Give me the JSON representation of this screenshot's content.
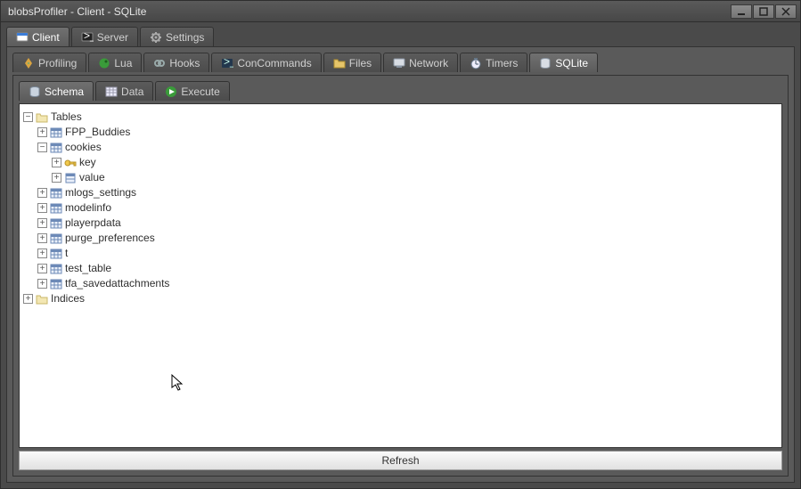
{
  "title": "blobsProfiler - Client - SQLite",
  "top_tabs": [
    {
      "id": "client",
      "label": "Client",
      "active": true
    },
    {
      "id": "server",
      "label": "Server",
      "active": false
    },
    {
      "id": "settings",
      "label": "Settings",
      "active": false
    }
  ],
  "mid_tabs": [
    {
      "id": "profiling",
      "label": "Profiling",
      "active": false
    },
    {
      "id": "lua",
      "label": "Lua",
      "active": false
    },
    {
      "id": "hooks",
      "label": "Hooks",
      "active": false
    },
    {
      "id": "concommands",
      "label": "ConCommands",
      "active": false
    },
    {
      "id": "files",
      "label": "Files",
      "active": false
    },
    {
      "id": "network",
      "label": "Network",
      "active": false
    },
    {
      "id": "timers",
      "label": "Timers",
      "active": false
    },
    {
      "id": "sqlite",
      "label": "SQLite",
      "active": true
    }
  ],
  "inner_tabs": [
    {
      "id": "schema",
      "label": "Schema",
      "active": true
    },
    {
      "id": "data",
      "label": "Data",
      "active": false
    },
    {
      "id": "execute",
      "label": "Execute",
      "active": false
    }
  ],
  "tree": {
    "tables_label": "Tables",
    "indices_label": "Indices",
    "tables": [
      {
        "name": "FPP_Buddies",
        "children": false
      },
      {
        "name": "cookies",
        "expanded": true,
        "cols": [
          {
            "name": "key",
            "pk": true
          },
          {
            "name": "value",
            "pk": false
          }
        ]
      },
      {
        "name": "mlogs_settings",
        "children": false
      },
      {
        "name": "modelinfo",
        "children": false
      },
      {
        "name": "playerpdata",
        "children": false
      },
      {
        "name": "purge_preferences",
        "children": false
      },
      {
        "name": "t",
        "children": false
      },
      {
        "name": "test_table",
        "children": false
      },
      {
        "name": "tfa_savedattachments",
        "children": false
      }
    ]
  },
  "refresh_label": "Refresh"
}
